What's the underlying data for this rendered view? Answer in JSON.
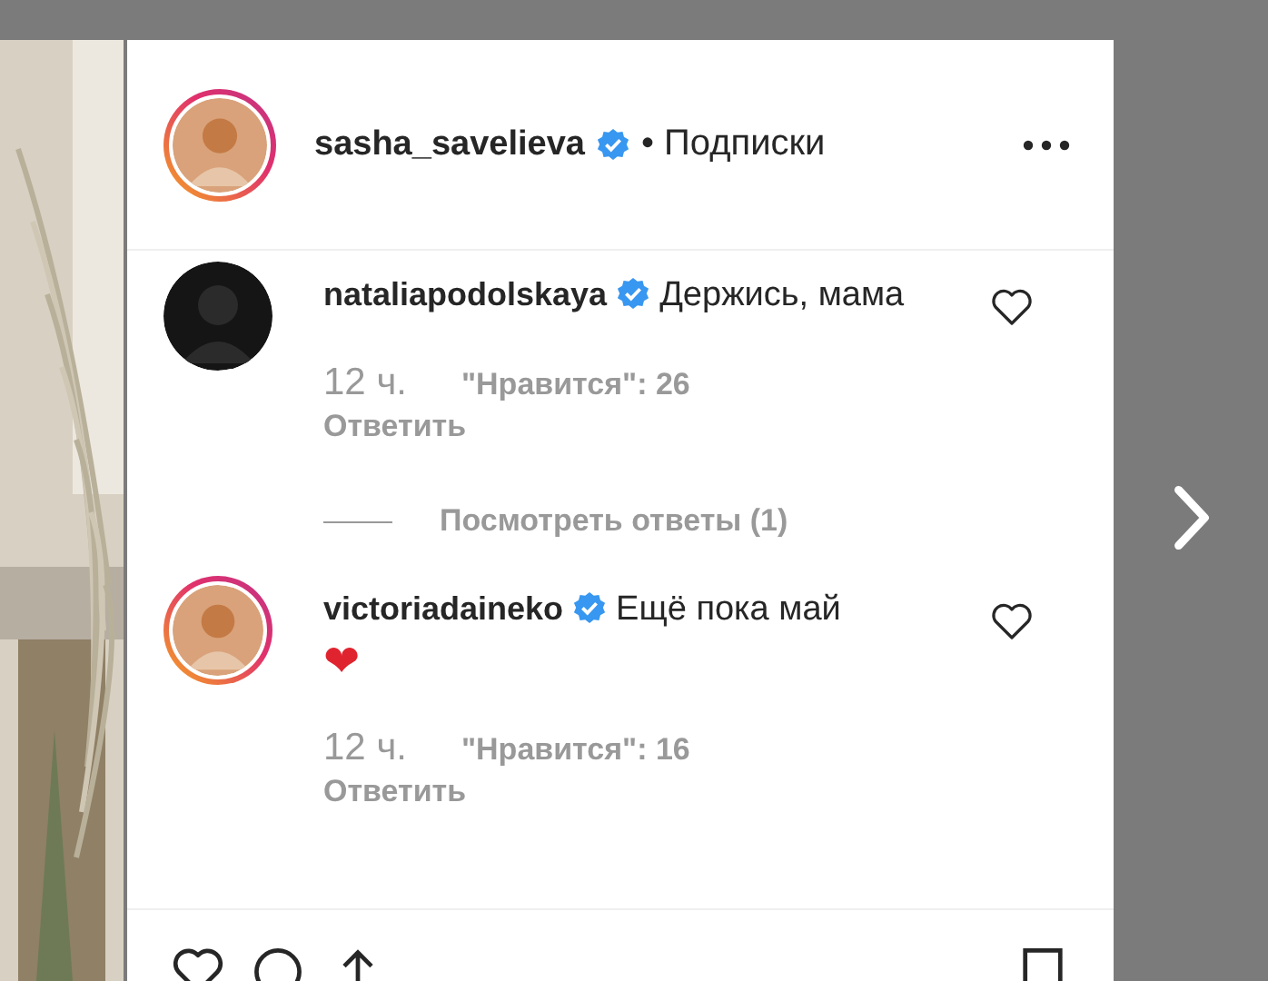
{
  "post": {
    "author": {
      "username": "sasha_savelieva",
      "verified": true,
      "has_story": true
    },
    "follow_label": "• Подписки"
  },
  "comments": [
    {
      "username": "nataliapodolskaya",
      "verified": true,
      "has_story": false,
      "text": "Держись, мама",
      "time": "12 ч.",
      "likes": "\"Нравится\": 26",
      "reply_label": "Ответить",
      "liked": false,
      "view_replies": "Посмотреть ответы (1)"
    },
    {
      "username": "victoriadaineko",
      "verified": true,
      "has_story": true,
      "text": "Ещё пока май",
      "emoji": "❤",
      "time": "12 ч.",
      "likes": "\"Нравится\": 16",
      "reply_label": "Ответить",
      "liked": false
    }
  ]
}
